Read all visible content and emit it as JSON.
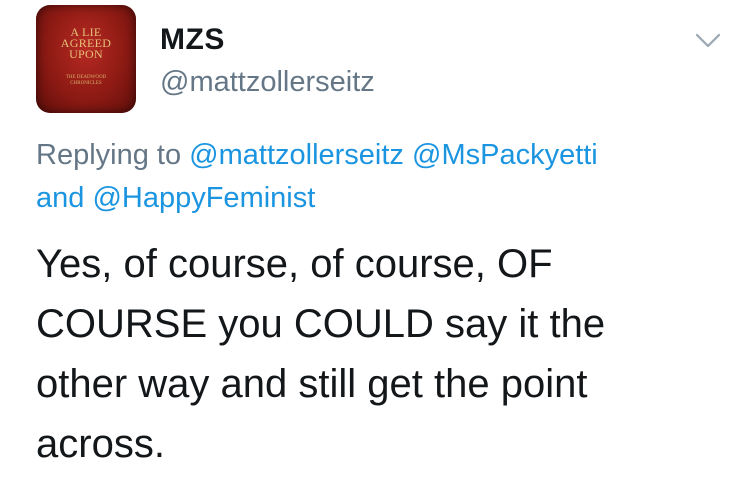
{
  "tweet": {
    "avatar": {
      "book_title_lines": [
        "A LIE",
        "AGREED",
        "UPON"
      ],
      "book_subtitle_lines": [
        "THE DEADWOOD",
        "CHRONICLES"
      ]
    },
    "display_name": "MZS",
    "handle": "@mattzollerseitz",
    "reply_prefix": "Replying to",
    "reply_mention_1": "@mattzollerseitz",
    "reply_mention_2": "@MsPackyetti",
    "reply_and": "and",
    "reply_mention_3": "@HappyFeminist",
    "text_lines": [
      "Yes, of course, of course, OF",
      "COURSE you COULD say it the",
      "other way and still get the point",
      "across."
    ],
    "icons": {
      "menu": "chevron-down-icon"
    },
    "colors": {
      "link": "#1b95e0",
      "muted": "#657786",
      "text": "#14171a"
    }
  }
}
